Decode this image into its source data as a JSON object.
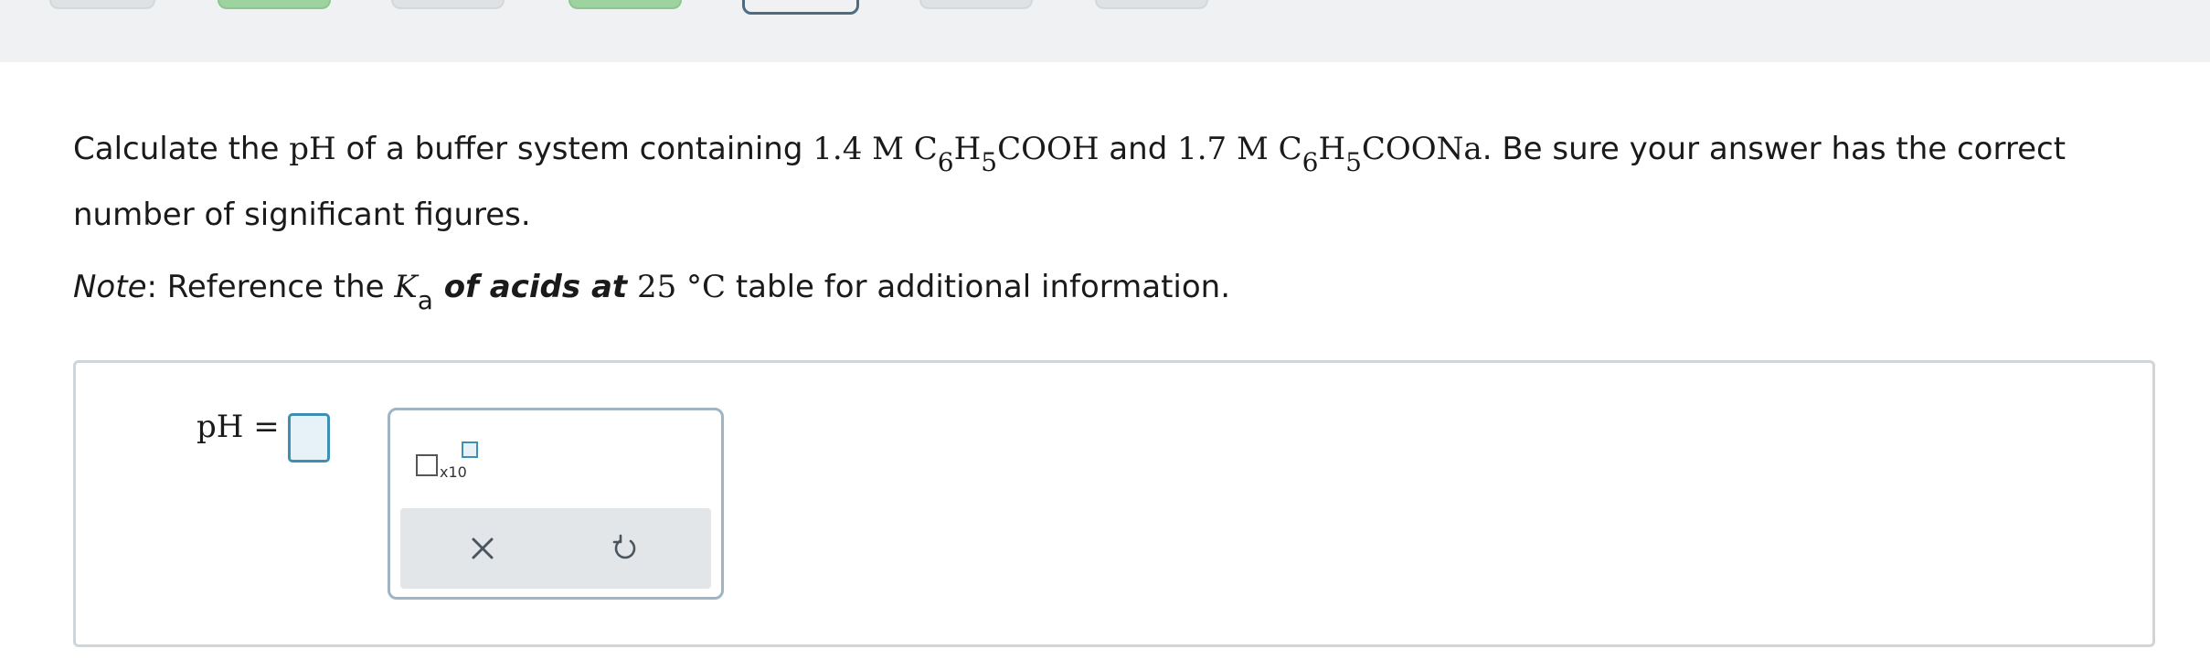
{
  "question": {
    "line1": {
      "t1": "Calculate the ",
      "ph": "pH",
      "t2": " of a buffer system containing ",
      "conc1": "1.4 M C",
      "sub6a": "6",
      "h1": "H",
      "sub5a": "5",
      "cooh": "COOH",
      "t3": " and ",
      "conc2": "1.7 M C",
      "sub6b": "6",
      "h2": "H",
      "sub5b": "5",
      "coona": "COONa",
      "t4": ". Be sure your answer has the correct"
    },
    "line2": "number of significant figures.",
    "note": {
      "label": "Note",
      "t1": ": Reference the ",
      "k": "K",
      "ksub": "a",
      "bold": " of acids at",
      "temp": " 25 °C",
      "t2": " table for additional information."
    }
  },
  "answer": {
    "label": "pH =",
    "value": ""
  },
  "keypad": {
    "sci_notation_label": "x10",
    "clear_icon": "close-icon",
    "undo_icon": "undo-icon"
  },
  "colors": {
    "input_border": "#3d8fb3",
    "input_fill": "#e6f2f8",
    "keypad_border": "#9fb4c4",
    "progress_complete": "#9ed39f",
    "progress_current_border": "#4e6b80"
  }
}
